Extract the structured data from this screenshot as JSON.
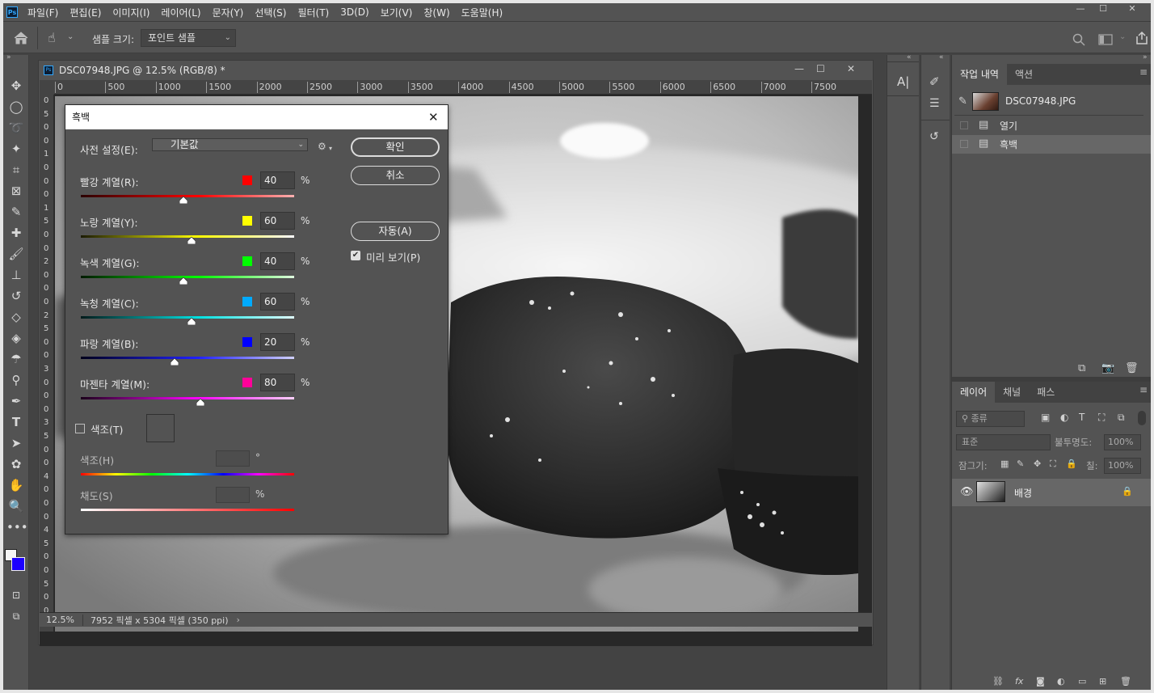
{
  "app": {
    "logo": "Ps"
  },
  "menu": [
    "파일(F)",
    "편집(E)",
    "이미지(I)",
    "레이어(L)",
    "문자(Y)",
    "선택(S)",
    "필터(T)",
    "3D(D)",
    "보기(V)",
    "창(W)",
    "도움말(H)"
  ],
  "options": {
    "sample_size_label": "샘플 크기:",
    "sample_size_value": "포인트 샘플"
  },
  "document": {
    "tab_title": "DSC07948.JPG @ 12.5% (RGB/8) *",
    "ruler_h": [
      "0",
      "500",
      "1000",
      "1500",
      "2000",
      "2500",
      "3000",
      "3500",
      "4000",
      "4500",
      "5000",
      "5500",
      "6000",
      "6500",
      "7000",
      "7500"
    ],
    "ruler_v": [
      "0",
      "5",
      "0",
      "0",
      "1",
      "0",
      "0",
      "0",
      "1",
      "5",
      "0",
      "0",
      "2",
      "0",
      "0",
      "0",
      "2",
      "5",
      "0",
      "0",
      "3",
      "0",
      "0",
      "0",
      "3",
      "5",
      "0",
      "0",
      "4",
      "0",
      "0",
      "0",
      "4",
      "5",
      "0",
      "0",
      "5",
      "0",
      "0"
    ],
    "zoom": "12.5%",
    "size_info": "7952 픽셀 x 5304 픽셀 (350 ppi)"
  },
  "dialog": {
    "title": "흑백",
    "preset_label": "사전 설정(E):",
    "preset_value": "기본값",
    "channels": [
      {
        "label": "빨강 계열(R):",
        "value": "40",
        "color": "#ff0000",
        "pct": 0.48,
        "from": "#2a0000",
        "to": "#ffb0b0",
        "mid": "#ff0000"
      },
      {
        "label": "노랑 계열(Y):",
        "value": "60",
        "color": "#ffff00",
        "pct": 0.52,
        "from": "#1a1a00",
        "to": "#ffffff",
        "mid": "#ffff00"
      },
      {
        "label": "녹색 계열(G):",
        "value": "40",
        "color": "#00ff00",
        "pct": 0.48,
        "from": "#001a00",
        "to": "#e0ffe0",
        "mid": "#00ff00"
      },
      {
        "label": "녹청 계열(C):",
        "value": "60",
        "color": "#00aaff",
        "pct": 0.52,
        "from": "#001a1a",
        "to": "#e0ffff",
        "mid": "#00e0e0"
      },
      {
        "label": "파랑 계열(B):",
        "value": "20",
        "color": "#0000ff",
        "pct": 0.44,
        "from": "#00001a",
        "to": "#d0d0ff",
        "mid": "#2020ff"
      },
      {
        "label": "마젠타 계열(M):",
        "value": "80",
        "color": "#ff0099",
        "pct": 0.56,
        "from": "#1a001a",
        "to": "#ffd0ff",
        "mid": "#ff00ff"
      }
    ],
    "tint_label": "색조(T)",
    "hue_label": "색조(H)",
    "hue_unit": "°",
    "sat_label": "채도(S)",
    "sat_unit": "%",
    "pct_unit": "%",
    "ok": "확인",
    "cancel": "취소",
    "auto": "자동(A)",
    "preview": "미리 보기(P)"
  },
  "history_panel": {
    "tabs": [
      "작업 내역",
      "액션"
    ],
    "snapshot": "DSC07948.JPG",
    "items": [
      "열기",
      "흑백"
    ]
  },
  "layers_panel": {
    "tabs": [
      "레이어",
      "채널",
      "패스"
    ],
    "filter": "종류",
    "blend": "표준",
    "opacity_label": "불투명도:",
    "opacity_value": "100%",
    "lock_label": "잠그기:",
    "fill_label": "칠:",
    "fill_value": "100%",
    "layer_name": "배경"
  }
}
